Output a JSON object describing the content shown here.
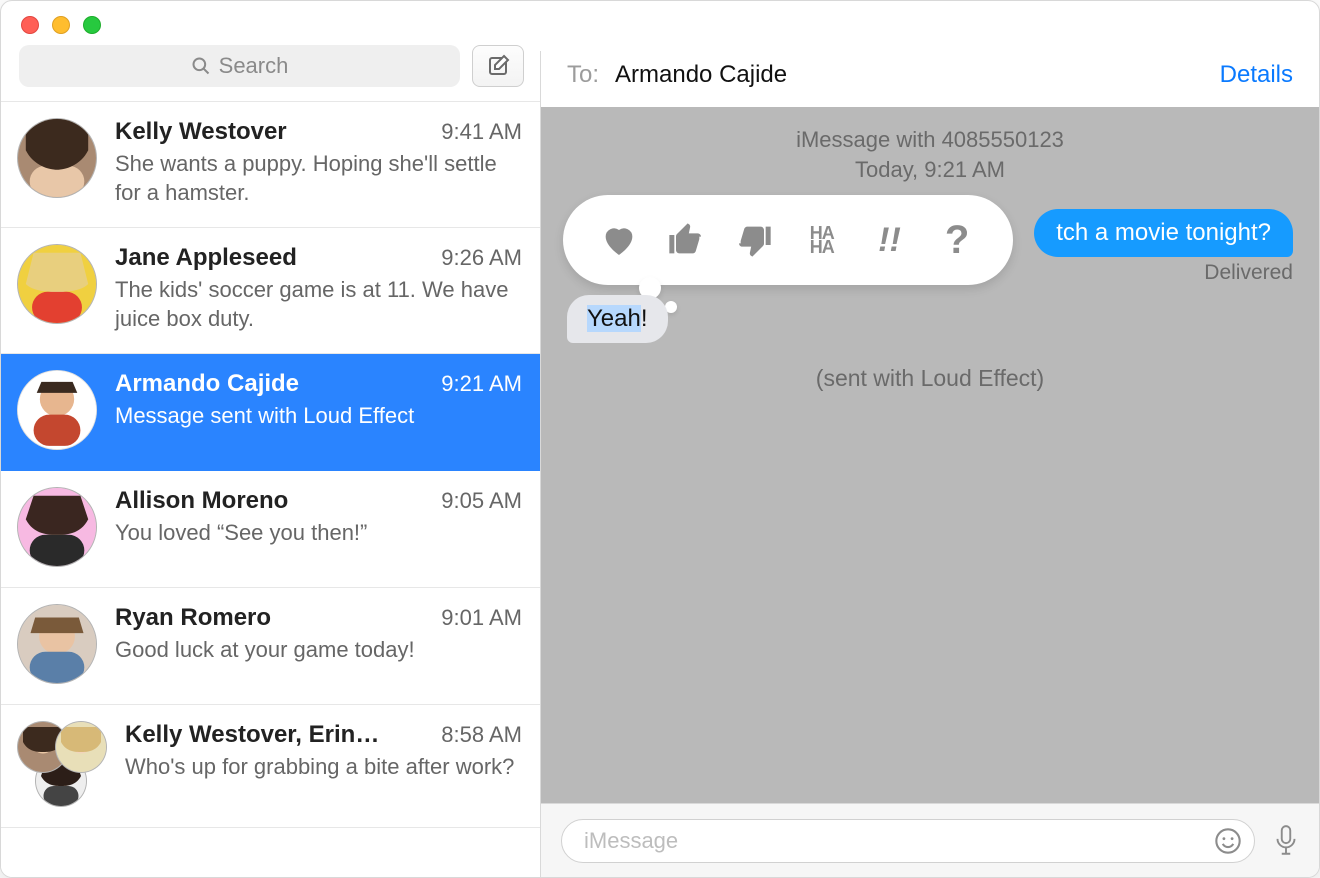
{
  "search": {
    "placeholder": "Search"
  },
  "conversations": [
    {
      "name": "Kelly Westover",
      "time": "9:41 AM",
      "preview": "She wants a puppy. Hoping she'll settle for a hamster."
    },
    {
      "name": "Jane Appleseed",
      "time": "9:26 AM",
      "preview": "The kids' soccer game is at 11. We have juice box duty."
    },
    {
      "name": "Armando Cajide",
      "time": "9:21 AM",
      "preview": "Message sent with Loud Effect"
    },
    {
      "name": "Allison Moreno",
      "time": "9:05 AM",
      "preview": "You loved “See you then!”"
    },
    {
      "name": "Ryan Romero",
      "time": "9:01 AM",
      "preview": "Good luck at your game today!"
    },
    {
      "name": "Kelly Westover, Erin…",
      "time": "8:58 AM",
      "preview": "Who's up for grabbing a bite after work?"
    }
  ],
  "header": {
    "to_label": "To:",
    "to_name": "Armando Cajide",
    "details": "Details"
  },
  "thread": {
    "meta1": "iMessage with 4085550123",
    "meta2": "Today, 9:21 AM",
    "sent_text": "tch a movie tonight?",
    "delivered": "Delivered",
    "recv_highlight": "Yeah",
    "recv_tail": "!",
    "effect": "(sent with Loud Effect)"
  },
  "tapback": {
    "haha": "HA\nHA",
    "bang": "!!",
    "q": "?"
  },
  "compose": {
    "placeholder": "iMessage"
  }
}
